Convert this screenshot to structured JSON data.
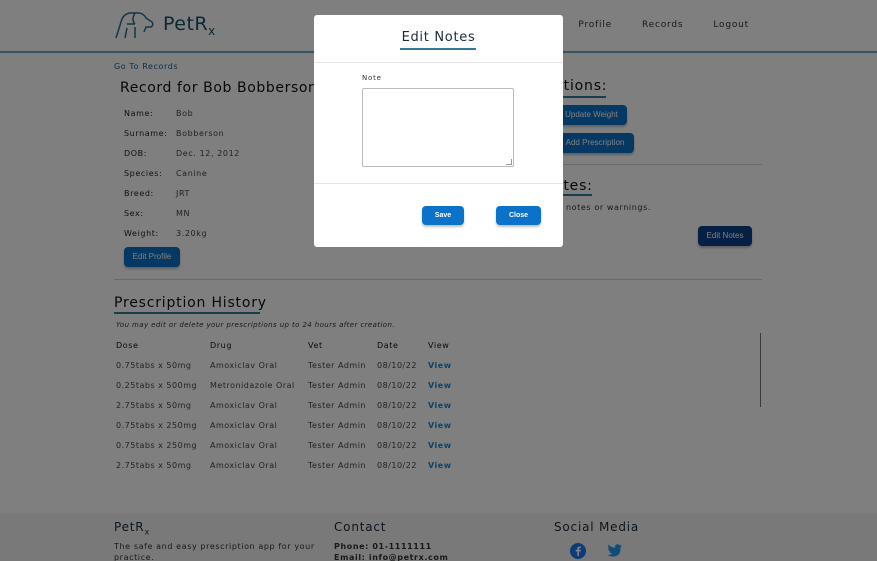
{
  "brand": {
    "name": "PetR",
    "sub": "x"
  },
  "nav": {
    "profile": "Profile",
    "records": "Records",
    "logout": "Logout"
  },
  "back_link": "Go To Records",
  "record_title": "Record for Bob Bobberson",
  "details": [
    {
      "label": "Name:",
      "value": "Bob"
    },
    {
      "label": "Surname:",
      "value": "Bobberson"
    },
    {
      "label": "DOB:",
      "value": "Dec. 12, 2012"
    },
    {
      "label": "Species:",
      "value": "Canine"
    },
    {
      "label": "Breed:",
      "value": "JRT"
    },
    {
      "label": "Sex:",
      "value": "MN"
    },
    {
      "label": "Weight:",
      "value": "3.20kg"
    }
  ],
  "edit_profile": "Edit Profile",
  "options": {
    "title": "ptions:",
    "update_weight": "Update Weight",
    "add_prescription": "Add Prescription"
  },
  "notes": {
    "title": "otes:",
    "text": "notes or warnings.",
    "edit_button": "Edit Notes"
  },
  "history": {
    "title": "Prescription History",
    "hint": "You may edit or delete your prescriptions up to 24 hours after creation.",
    "columns": [
      "Dose",
      "Drug",
      "Vet",
      "Date",
      "View"
    ],
    "rows": [
      [
        "0.75tabs x 50mg",
        "Amoxiclav Oral",
        "Tester Admin",
        "08/10/22",
        "View"
      ],
      [
        "0.25tabs x 500mg",
        "Metronidazole Oral",
        "Tester Admin",
        "08/10/22",
        "View"
      ],
      [
        "2.75tabs x 50mg",
        "Amoxiclav Oral",
        "Tester Admin",
        "08/10/22",
        "View"
      ],
      [
        "0.75tabs x 250mg",
        "Amoxiclav Oral",
        "Tester Admin",
        "08/10/22",
        "View"
      ],
      [
        "0.75tabs x 250mg",
        "Amoxiclav Oral",
        "Tester Admin",
        "08/10/22",
        "View"
      ],
      [
        "2.75tabs x 50mg",
        "Amoxiclav Oral",
        "Tester Admin",
        "08/10/22",
        "View"
      ]
    ]
  },
  "footer": {
    "brand": "PetR",
    "brand_sub": "x",
    "tagline_1": "The safe and easy prescription app for your",
    "tagline_2": "practice.",
    "contact_title": "Contact",
    "phone": "Phone: 01-1111111",
    "email": "Email: info@petrx.com",
    "social_title": "Social Media"
  },
  "modal": {
    "title": "Edit Notes",
    "note_label": "Note",
    "note_value": "",
    "save": "Save",
    "close": "Close"
  },
  "colors": {
    "accent": "#0a72c8",
    "overlay": "rgba(0,0,0,0.5)"
  }
}
